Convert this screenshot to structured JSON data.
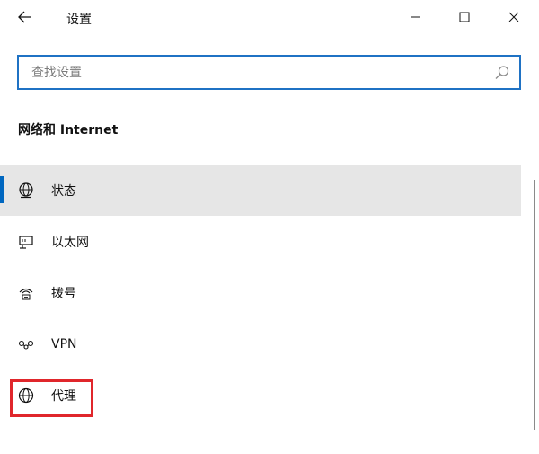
{
  "titlebar": {
    "title": "设置"
  },
  "search": {
    "placeholder": "查找设置",
    "value": ""
  },
  "section": {
    "title": "网络和 Internet"
  },
  "nav": {
    "items": [
      {
        "label": "状态",
        "icon": "globe-status-icon",
        "active": true
      },
      {
        "label": "以太网",
        "icon": "ethernet-icon",
        "active": false
      },
      {
        "label": "拨号",
        "icon": "dialup-icon",
        "active": false
      },
      {
        "label": "VPN",
        "icon": "vpn-icon",
        "active": false
      },
      {
        "label": "代理",
        "icon": "globe-icon",
        "active": false
      }
    ]
  },
  "colors": {
    "accent": "#0067c0",
    "search_border": "#1f72c4",
    "active_bg": "#e6e6e6",
    "highlight": "#e0262b"
  }
}
